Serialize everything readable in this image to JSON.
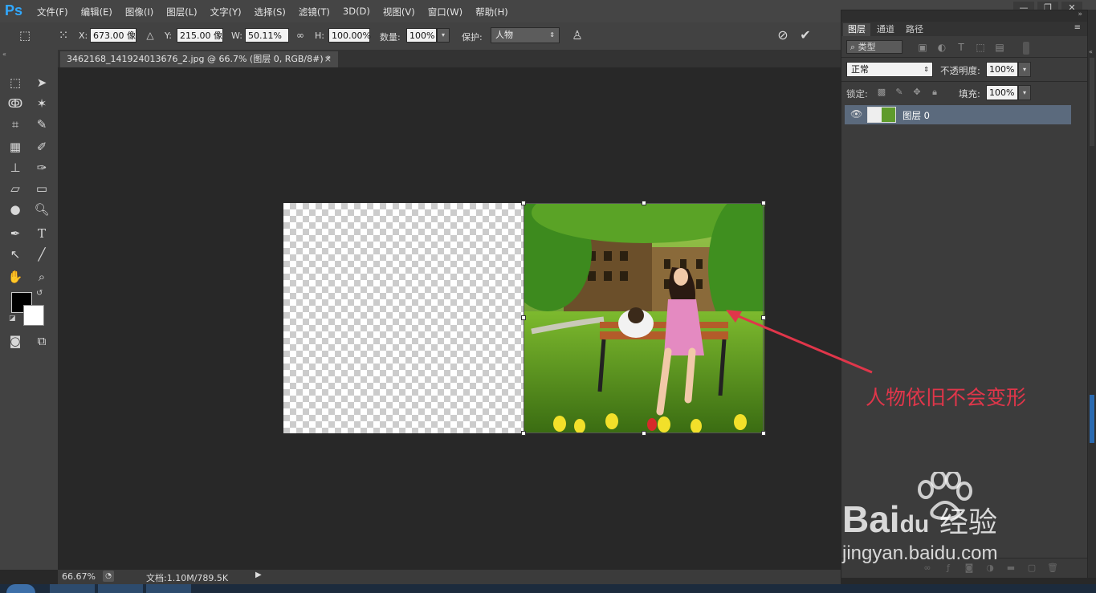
{
  "app": {
    "logo": "Ps"
  },
  "menu": [
    "文件(F)",
    "编辑(E)",
    "图像(I)",
    "图层(L)",
    "文字(Y)",
    "选择(S)",
    "滤镜(T)",
    "3D(D)",
    "视图(V)",
    "窗口(W)",
    "帮助(H)"
  ],
  "options": {
    "x_label": "X:",
    "x_value": "673.00 像",
    "y_label": "Y:",
    "y_value": "215.00 像",
    "w_label": "W:",
    "w_value": "50.11%",
    "h_label": "H:",
    "h_value": "100.00%",
    "amount_label": "数量:",
    "amount_value": "100%",
    "protect_label": "保护:",
    "protect_value": "人物"
  },
  "document": {
    "tab_title": "3462168_141924013676_2.jpg @ 66.7% (图层 0, RGB/8#) *",
    "close": "×"
  },
  "status": {
    "zoom": "66.67%",
    "doc_info": "文档:1.10M/789.5K"
  },
  "layers_panel": {
    "tabs": [
      "图层",
      "通道",
      "路径"
    ],
    "filter_label": "类型",
    "blend_mode": "正常",
    "opacity_label": "不透明度:",
    "opacity_value": "100%",
    "lock_label": "锁定:",
    "fill_label": "填充:",
    "fill_value": "100%",
    "layer_name": "图层 0"
  },
  "annotation": "人物依旧不会变形",
  "watermark": {
    "brand": "Bai",
    "brand_tail": "du",
    "suffix": "经验",
    "url": "jingyan.baidu.com"
  },
  "colors": {
    "annotation": "#e0364a",
    "selected_layer": "#5b6a7d",
    "accent": "#31a8ff"
  }
}
